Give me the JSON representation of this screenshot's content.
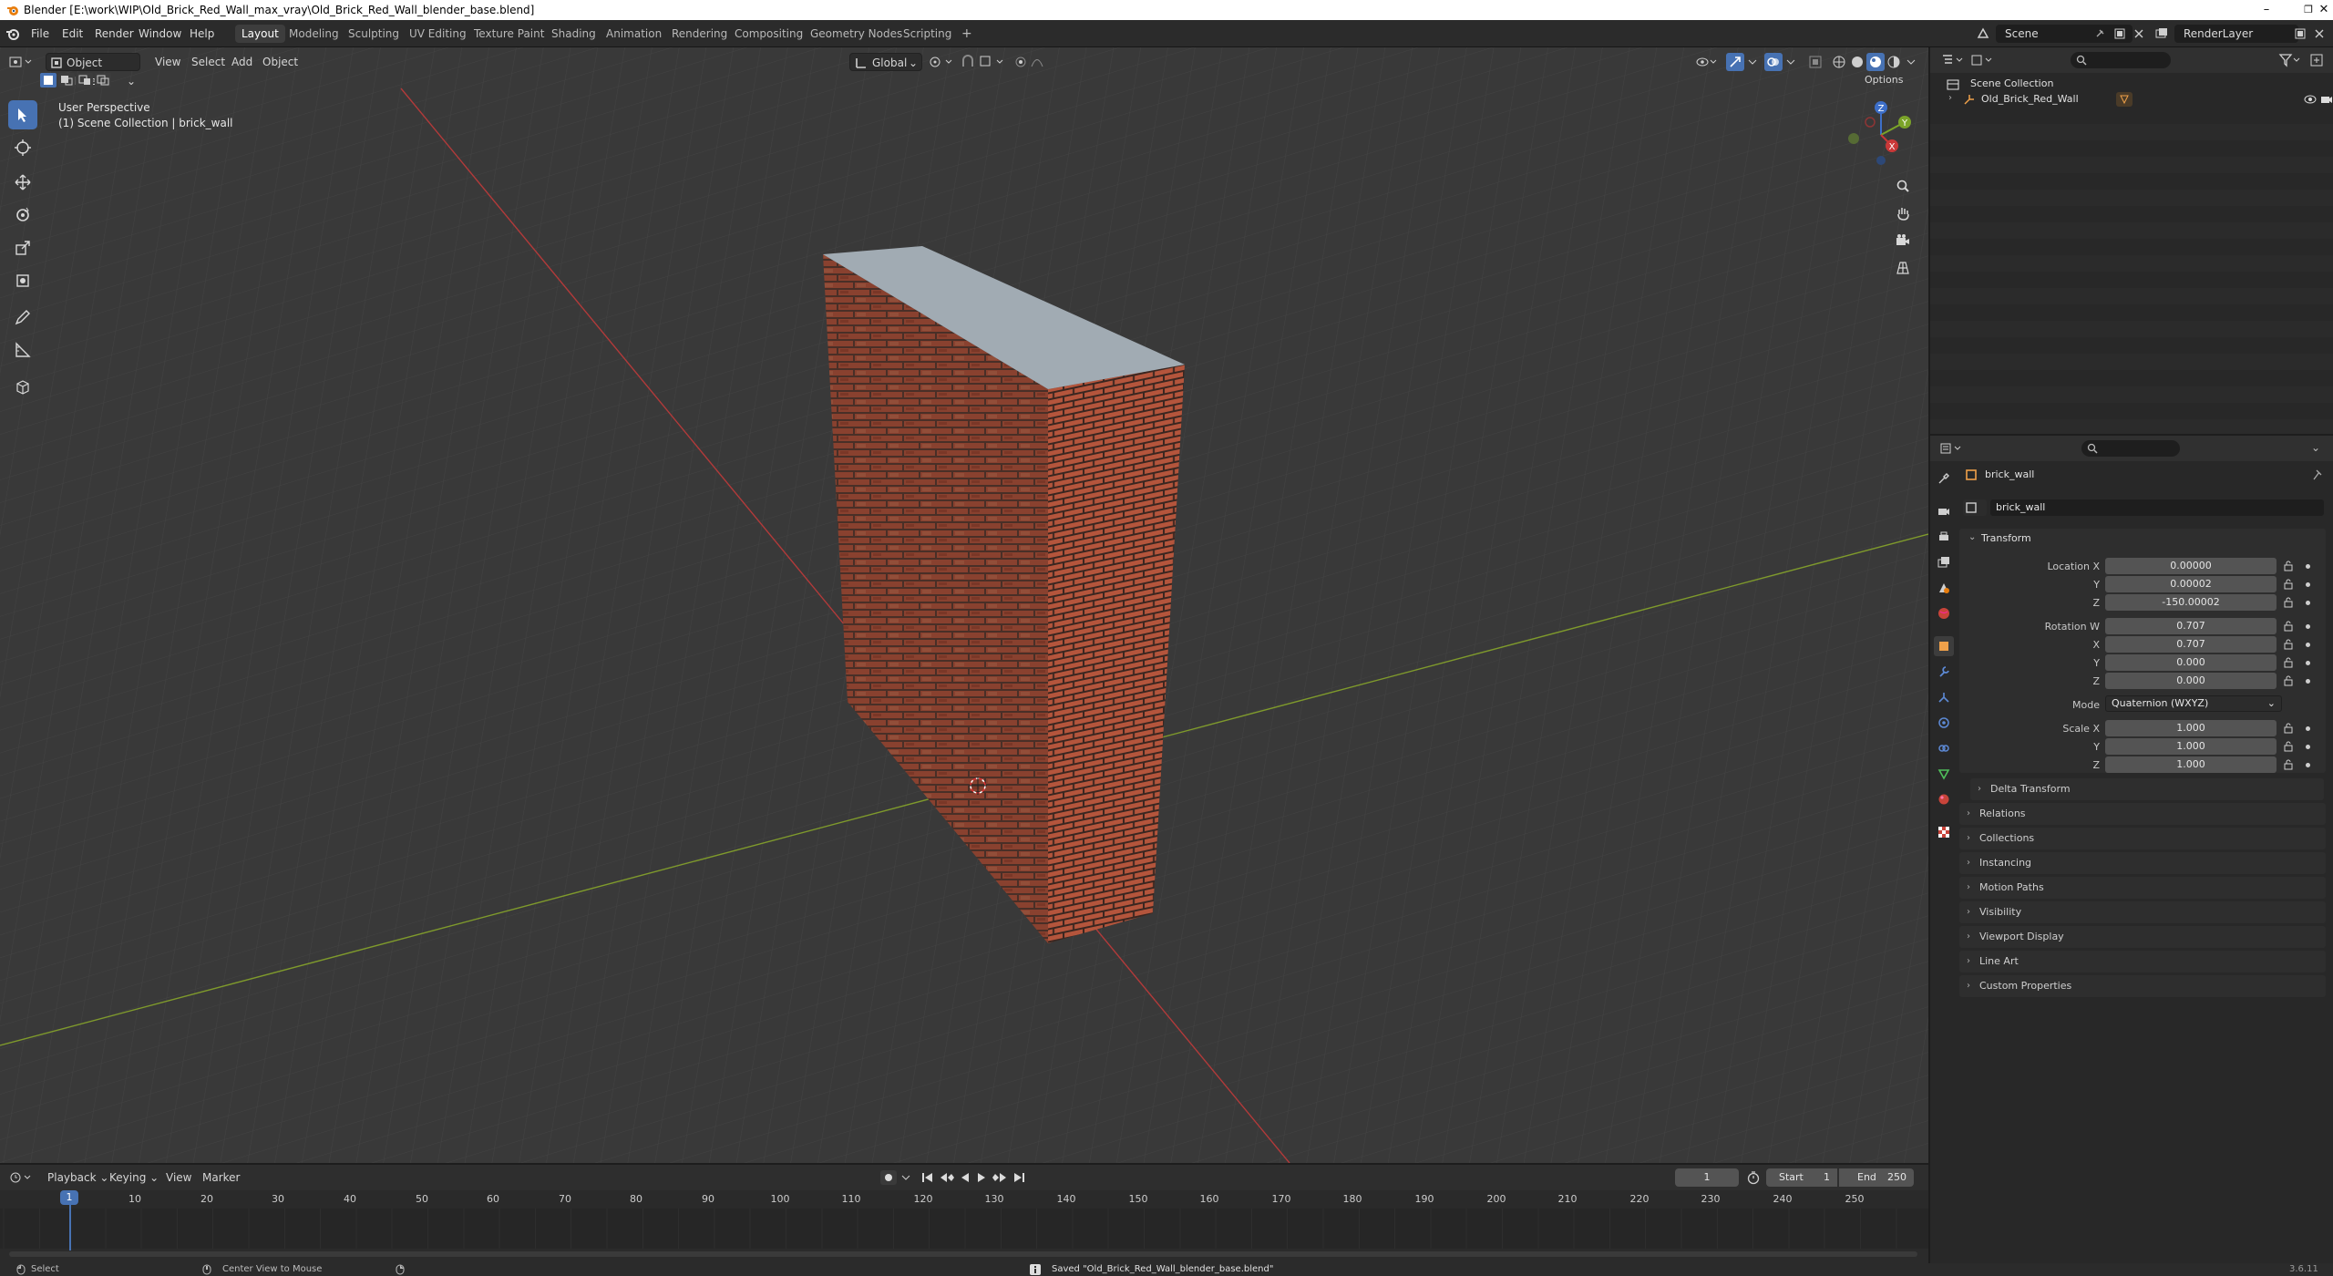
{
  "window": {
    "title": "Blender [E:\\work\\WIP\\Old_Brick_Red_Wall_max_vray\\Old_Brick_Red_Wall_blender_base.blend]",
    "minimize": "–",
    "maximize": "❐",
    "close": "✕"
  },
  "menu": {
    "file": "File",
    "edit": "Edit",
    "render": "Render",
    "window": "Window",
    "help": "Help"
  },
  "workspaces": [
    "Layout",
    "Modeling",
    "Sculpting",
    "UV Editing",
    "Texture Paint",
    "Shading",
    "Animation",
    "Rendering",
    "Compositing",
    "Geometry Nodes",
    "Scripting"
  ],
  "workspace_add": "+",
  "scene": {
    "name": "Scene",
    "render_layer": "RenderLayer"
  },
  "viewport": {
    "mode": "Object Mode",
    "view": "View",
    "select": "Select",
    "add": "Add",
    "object": "Object",
    "orientation": "Global",
    "options": "Options",
    "overlay_title": "User Perspective",
    "overlay_sub": "(1) Scene Collection | brick_wall",
    "gizmo": {
      "x": "X",
      "y": "Y",
      "z": "Z"
    }
  },
  "outliner": {
    "root": "Scene Collection",
    "items": [
      {
        "label": "Old_Brick_Red_Wall"
      }
    ]
  },
  "properties": {
    "object_name": "brick_wall",
    "data_name": "brick_wall",
    "transform_title": "Transform",
    "location": {
      "label_x": "Location X",
      "label_y": "Y",
      "label_z": "Z",
      "x": "0.00000",
      "y": "0.00002",
      "z": "-150.00002"
    },
    "rotation": {
      "label_w": "Rotation W",
      "label_x": "X",
      "label_y": "Y",
      "label_z": "Z",
      "w": "0.707",
      "x": "0.707",
      "y": "0.000",
      "z": "0.000"
    },
    "mode": {
      "label": "Mode",
      "value": "Quaternion (WXYZ)"
    },
    "scale": {
      "label_x": "Scale X",
      "label_y": "Y",
      "label_z": "Z",
      "x": "1.000",
      "y": "1.000",
      "z": "1.000"
    },
    "delta_transform": "Delta Transform",
    "panels": [
      "Relations",
      "Collections",
      "Instancing",
      "Motion Paths",
      "Visibility",
      "Viewport Display",
      "Line Art",
      "Custom Properties"
    ]
  },
  "timeline": {
    "playback": "Playback",
    "keying": "Keying",
    "view": "View",
    "marker": "Marker",
    "current_frame": "1",
    "start_label": "Start",
    "start": "1",
    "end_label": "End",
    "end": "250",
    "ticks": [
      "10",
      "20",
      "30",
      "40",
      "50",
      "60",
      "70",
      "80",
      "90",
      "100",
      "110",
      "120",
      "130",
      "140",
      "150",
      "160",
      "170",
      "180",
      "190",
      "200",
      "210",
      "220",
      "230",
      "240",
      "250"
    ],
    "playhead": "1"
  },
  "status": {
    "select": "Select",
    "center": "Center View to Mouse",
    "saved": "Saved \"Old_Brick_Red_Wall_blender_base.blend\"",
    "version": "3.6.11"
  }
}
